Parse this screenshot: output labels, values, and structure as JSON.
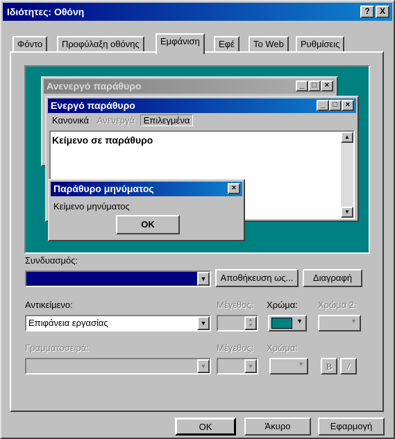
{
  "window": {
    "title": "Ιδιότητες: Οθόνη",
    "help_button": "?",
    "close_button": "X"
  },
  "tabs": [
    {
      "label": "Φόντο"
    },
    {
      "label": "Προφύλαξη οθόνης"
    },
    {
      "label": "Εμφάνιση"
    },
    {
      "label": "Εφέ"
    },
    {
      "label": "Το Web"
    },
    {
      "label": "Ρυθμίσεις"
    }
  ],
  "preview": {
    "inactive_title": "Ανενεργό παράθυρο",
    "active_title": "Ενεργό παράθυρο",
    "menu_normal": "Κανονικά",
    "menu_disabled": "Ανενεργά",
    "menu_selected": "Επιλεγμένα",
    "window_text": "Κείμενο σε παράθυρο",
    "msgbox_title": "Παράθυρο μηνύματος",
    "msgbox_text": "Κείμενο μηνύματος",
    "msgbox_ok": "OK",
    "colors": {
      "desktop": "#008080",
      "active_title": "#000080",
      "inactive_title": "#808080"
    }
  },
  "scheme": {
    "label": "Συνδυασμός:",
    "value": "",
    "save_as": "Αποθήκευση ως...",
    "delete": "Διαγραφή",
    "selected_color": "#000080"
  },
  "item": {
    "label": "Αντικείμενο:",
    "value": "Επιφάνεια εργασίας",
    "size_label": "Μέγεθος:",
    "color_label": "Χρώμα:",
    "color2_label": "Χρώμα 2:",
    "color_value": "#008080"
  },
  "font": {
    "label": "Γραμματοσειρά:",
    "size_label": "Μέγεθος:",
    "color_label": "Χρώμα:",
    "bold": "B",
    "italic": "/"
  },
  "footer": {
    "ok": "OK",
    "cancel": "Άκυρο",
    "apply": "Εφαρμογή"
  }
}
